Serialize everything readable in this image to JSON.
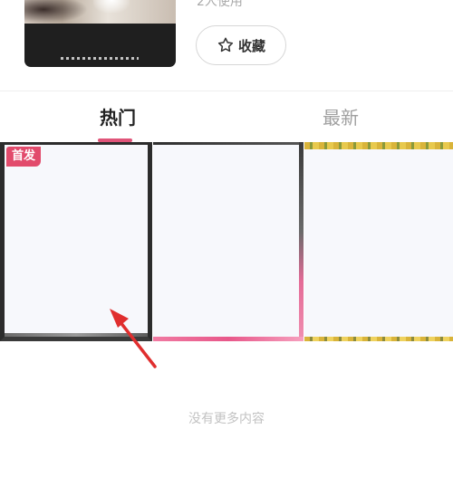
{
  "template": {
    "usage_text": "2人使用",
    "favorite_label": "收藏"
  },
  "tabs": [
    {
      "label": "热门",
      "active": true
    },
    {
      "label": "最新",
      "active": false
    }
  ],
  "grid": {
    "cards": [
      {
        "badge": "首发"
      },
      {
        "badge": ""
      },
      {
        "badge": ""
      }
    ]
  },
  "footer": {
    "no_more_text": "没有更多内容"
  },
  "colors": {
    "accent": "#e05479",
    "badge": "#e24b6c",
    "arrow": "#e02e2e"
  },
  "icons": {
    "favorite": "star-outline-icon"
  }
}
